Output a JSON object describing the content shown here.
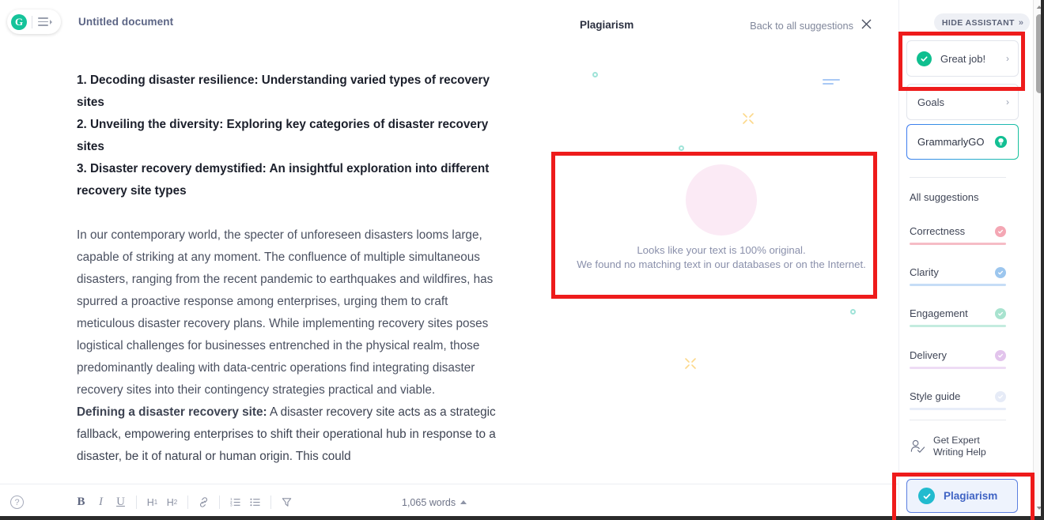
{
  "window": {
    "title_bar_color": "#2b2b2b"
  },
  "editor": {
    "logo_name": "grammarly-logo",
    "menu_icon": "hamburger-menu-icon",
    "document_title": "Untitled document",
    "headings": [
      "1. Decoding disaster resilience: Understanding varied types of recovery sites",
      "2. Unveiling the diversity: Exploring key categories of disaster recovery sites",
      "3. Disaster recovery demystified: An insightful exploration into different recovery site types"
    ],
    "paragraph_1": " In our contemporary world, the specter of unforeseen disasters looms large, capable of striking at any moment. The confluence of multiple simultaneous disasters, ranging from the recent pandemic to earthquakes and wildfires, has spurred a proactive response among enterprises, urging them to craft meticulous disaster recovery plans. While implementing recovery sites poses logistical challenges for businesses entrenched in the physical realm, those predominantly dealing with data-centric operations find integrating disaster recovery sites into their contingency strategies practical and viable.",
    "paragraph_2_bold": "Defining a disaster recovery site:",
    "paragraph_2_rest": " A disaster recovery site acts as a strategic fallback, empowering enterprises to shift their operational hub in response to a disaster, be it of natural or human origin. This could"
  },
  "toolbar": {
    "help_icon": "help-circle-icon",
    "bold_label": "B",
    "italic_label": "I",
    "underline_label": "U",
    "h1_label": "H",
    "h1_sub": "1",
    "h2_label": "H",
    "h2_sub": "2",
    "link_icon": "link-icon",
    "numbered_list_icon": "numbered-list-icon",
    "bullet_list_icon": "bullet-list-icon",
    "clear_format_icon": "clear-formatting-icon",
    "word_count": "1,065 words"
  },
  "plagiarism_panel": {
    "title": "Plagiarism",
    "back_link": "Back to all suggestions",
    "close_icon": "close-icon",
    "illustration": "lightbulb-icon",
    "message_line1": "Looks like your text is 100% original.",
    "message_line2": "We found no matching text in our databases or on the Internet."
  },
  "sidebar": {
    "hide_assistant_label": "HIDE ASSISTANT",
    "hide_assistant_chevron": "»",
    "score_card": {
      "label": "Great job!",
      "icon": "check-circle-icon",
      "arrow": "›"
    },
    "goals_card": {
      "label": "Goals",
      "arrow": "›"
    },
    "grammarly_go": {
      "label": "GrammarlyGO",
      "icon": "lightbulb-icon"
    },
    "all_suggestions_label": "All suggestions",
    "categories": [
      {
        "label": "Correctness",
        "color": "#f4a7b4",
        "bar_color": "#f6bcc6",
        "icon": "check-circle-icon"
      },
      {
        "label": "Clarity",
        "color": "#9cc6ee",
        "bar_color": "#bcd8f4",
        "icon": "check-circle-icon"
      },
      {
        "label": "Engagement",
        "color": "#a8e3cf",
        "bar_color": "#bfeade",
        "icon": "check-circle-icon"
      },
      {
        "label": "Delivery",
        "color": "#e2c4ec",
        "bar_color": "#eed6f3",
        "icon": "check-circle-icon"
      },
      {
        "label": "Style guide",
        "color": "#dde3f3",
        "bar_color": "#e3e8f6",
        "icon": "check-circle-icon"
      }
    ],
    "expert_help": {
      "line1": "Get Expert",
      "line2": "Writing Help",
      "icon": "person-check-icon"
    },
    "plagiarism_button": {
      "label": "Plagiarism",
      "icon": "check-circle-icon"
    }
  },
  "scrollbar": {
    "up_arrow_icon": "caret-up-icon",
    "down_arrow_icon": "caret-down-icon"
  },
  "annotations": {
    "color": "#ee1b1b",
    "boxes": [
      "great-job-card",
      "plagiarism-result-card",
      "plagiarism-sidebar-button"
    ]
  }
}
